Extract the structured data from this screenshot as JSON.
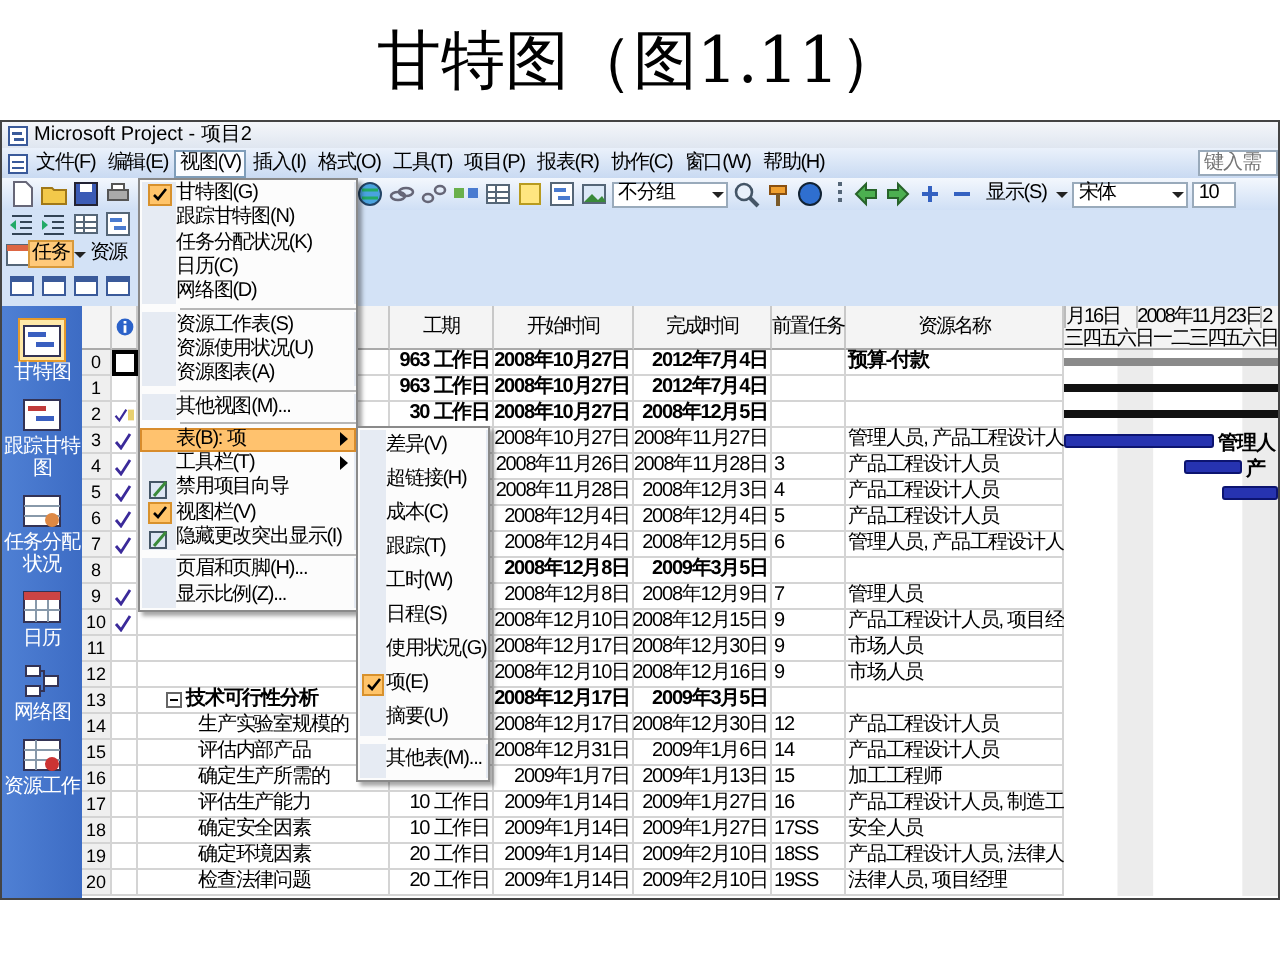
{
  "slide": {
    "title": "甘特图（图1.11）"
  },
  "window": {
    "title": "Microsoft Project - 项目2"
  },
  "menu_bar": [
    {
      "label": "文件(F)",
      "selected": false
    },
    {
      "label": "编辑(E)",
      "selected": false
    },
    {
      "label": "视图(V)",
      "selected": true
    },
    {
      "label": "插入(I)",
      "selected": false
    },
    {
      "label": "格式(O)",
      "selected": false
    },
    {
      "label": "工具(T)",
      "selected": false
    },
    {
      "label": "项目(P)",
      "selected": false
    },
    {
      "label": "报表(R)",
      "selected": false
    },
    {
      "label": "协作(C)",
      "selected": false
    },
    {
      "label": "窗口(W)",
      "selected": false
    },
    {
      "label": "帮助(H)",
      "selected": false
    }
  ],
  "help_box": {
    "placeholder": "键入需"
  },
  "toolbar": {
    "grouping": "不分组",
    "show_button": "显示(S)",
    "font": "宋体",
    "font_size": "10"
  },
  "view_tabs": [
    {
      "label": "任务",
      "selected": true
    },
    {
      "label": "资源",
      "selected": false
    }
  ],
  "view_bar": [
    {
      "label": "甘特图",
      "selected": true
    },
    {
      "label": "跟踪甘特图",
      "selected": false
    },
    {
      "label": "任务分配状况",
      "selected": false
    },
    {
      "label": "日历",
      "selected": false
    },
    {
      "label": "网络图",
      "selected": false
    },
    {
      "label": "资源工作",
      "selected": false
    }
  ],
  "view_menu": [
    {
      "kind": "item",
      "label": "甘特图(G)",
      "checked": true,
      "selected": false,
      "submenu": false
    },
    {
      "kind": "item",
      "label": "跟踪甘特图(N)",
      "checked": false,
      "selected": false,
      "submenu": false
    },
    {
      "kind": "item",
      "label": "任务分配状况(K)",
      "checked": false,
      "selected": false,
      "submenu": false
    },
    {
      "kind": "item",
      "label": "日历(C)",
      "checked": false,
      "selected": false,
      "submenu": false
    },
    {
      "kind": "item",
      "label": "网络图(D)",
      "checked": false,
      "selected": false,
      "submenu": false
    },
    {
      "kind": "separator"
    },
    {
      "kind": "item",
      "label": "资源工作表(S)",
      "checked": false,
      "selected": false,
      "submenu": false
    },
    {
      "kind": "item",
      "label": "资源使用状况(U)",
      "checked": false,
      "selected": false,
      "submenu": false
    },
    {
      "kind": "item",
      "label": "资源图表(A)",
      "checked": false,
      "selected": false,
      "submenu": false
    },
    {
      "kind": "separator"
    },
    {
      "kind": "item",
      "label": "其他视图(M)...",
      "checked": false,
      "selected": false,
      "submenu": false
    },
    {
      "kind": "separator"
    },
    {
      "kind": "item",
      "label": "表(B): 项",
      "checked": false,
      "selected": true,
      "submenu": true
    },
    {
      "kind": "item",
      "label": "工具栏(T)",
      "checked": false,
      "selected": false,
      "submenu": true
    },
    {
      "kind": "icon",
      "label": "禁用项目向导",
      "checked": false,
      "selected": false,
      "submenu": false
    },
    {
      "kind": "item",
      "label": "视图栏(V)",
      "checked": true,
      "selected": false,
      "submenu": false
    },
    {
      "kind": "icon",
      "label": "隐藏更改突出显示(I)",
      "checked": false,
      "selected": false,
      "submenu": false
    },
    {
      "kind": "separator"
    },
    {
      "kind": "item",
      "label": "页眉和页脚(H)...",
      "checked": false,
      "selected": false,
      "submenu": false
    },
    {
      "kind": "item",
      "label": "显示比例(Z)...",
      "checked": false,
      "selected": false,
      "submenu": false
    }
  ],
  "table_submenu": [
    {
      "kind": "item",
      "label": "差异(V)",
      "checked": false
    },
    {
      "kind": "item",
      "label": "超链接(H)",
      "checked": false
    },
    {
      "kind": "item",
      "label": "成本(C)",
      "checked": false
    },
    {
      "kind": "item",
      "label": "跟踪(T)",
      "checked": false
    },
    {
      "kind": "item",
      "label": "工时(W)",
      "checked": false
    },
    {
      "kind": "item",
      "label": "日程(S)",
      "checked": false
    },
    {
      "kind": "item",
      "label": "使用状况(G)",
      "checked": false
    },
    {
      "kind": "item",
      "label": "项(E)",
      "checked": true
    },
    {
      "kind": "item",
      "label": "摘要(U)",
      "checked": false
    },
    {
      "kind": "separator"
    },
    {
      "kind": "item",
      "label": "其他表(M)...",
      "checked": false
    }
  ],
  "table": {
    "columns": [
      "工期",
      "开始时间",
      "完成时间",
      "前置任务",
      "资源名称"
    ],
    "rows": [
      {
        "id": "0",
        "done": false,
        "note": false,
        "selected": true,
        "expanded": false,
        "summary": true,
        "duration": "963 工作日",
        "start": "2008年10月27日",
        "finish": "2012年7月4日",
        "resources": "预算-付款",
        "bar": {
          "kind": "project"
        }
      },
      {
        "id": "1",
        "done": false,
        "note": false,
        "selected": false,
        "expanded": false,
        "summary": true,
        "duration": "963 工作日",
        "start": "2008年10月27日",
        "finish": "2012年7月4日",
        "bar": {
          "kind": "summary"
        }
      },
      {
        "id": "2",
        "done": true,
        "note": true,
        "selected": false,
        "expanded": false,
        "summary": true,
        "duration": "30 工作日",
        "start": "2008年10月27日",
        "finish": "2008年12月5日",
        "bar": {
          "kind": "summary"
        }
      },
      {
        "id": "3",
        "done": true,
        "note": false,
        "selected": false,
        "expanded": false,
        "summary": false,
        "start": "2008年10月27日",
        "finish": "2008年11月27日",
        "resources": "管理人员, 产品工程设计人",
        "bar": {
          "kind": "task",
          "label": "管理人"
        }
      },
      {
        "id": "4",
        "done": true,
        "note": false,
        "selected": false,
        "expanded": false,
        "summary": false,
        "start": "2008年11月26日",
        "finish": "2008年11月28日",
        "predecessors": "3",
        "resources": "产品工程设计人员",
        "bar": {
          "kind": "task",
          "label": "产"
        }
      },
      {
        "id": "5",
        "done": true,
        "note": false,
        "selected": false,
        "expanded": false,
        "summary": false,
        "start": "2008年11月28日",
        "finish": "2008年12月3日",
        "predecessors": "4",
        "resources": "产品工程设计人员",
        "bar": {
          "kind": "task"
        }
      },
      {
        "id": "6",
        "done": true,
        "note": false,
        "selected": false,
        "expanded": false,
        "summary": false,
        "start": "2008年12月4日",
        "finish": "2008年12月4日",
        "predecessors": "5",
        "resources": "产品工程设计人员"
      },
      {
        "id": "7",
        "done": true,
        "note": false,
        "selected": false,
        "expanded": false,
        "summary": false,
        "start": "2008年12月4日",
        "finish": "2008年12月5日",
        "predecessors": "6",
        "resources": "管理人员, 产品工程设计人"
      },
      {
        "id": "8",
        "done": false,
        "note": false,
        "selected": false,
        "expanded": false,
        "summary": true,
        "start": "2008年12月8日",
        "finish": "2009年3月5日"
      },
      {
        "id": "9",
        "done": true,
        "note": false,
        "selected": false,
        "expanded": false,
        "summary": false,
        "start": "2008年12月8日",
        "finish": "2008年12月9日",
        "predecessors": "7",
        "resources": "管理人员"
      },
      {
        "id": "10",
        "done": true,
        "note": false,
        "selected": false,
        "expanded": false,
        "summary": false,
        "start": "2008年12月10日",
        "finish": "2008年12月15日",
        "predecessors": "9",
        "resources": "产品工程设计人员, 项目经"
      },
      {
        "id": "11",
        "done": false,
        "note": false,
        "selected": false,
        "expanded": false,
        "summary": false,
        "start": "2008年12月17日",
        "finish": "2008年12月30日",
        "predecessors": "9",
        "resources": "市场人员"
      },
      {
        "id": "12",
        "done": false,
        "note": false,
        "selected": false,
        "expanded": false,
        "summary": false,
        "start": "2008年12月10日",
        "finish": "2008年12月16日",
        "predecessors": "9",
        "resources": "市场人员"
      },
      {
        "id": "13",
        "done": false,
        "note": false,
        "selected": false,
        "expanded": true,
        "summary": true,
        "task": "技术可行性分析",
        "start": "2008年12月17日",
        "finish": "2009年3月5日",
        "children": [
          {
            "id": "14",
            "done": false,
            "note": false,
            "selected": false,
            "expanded": false,
            "summary": false,
            "task": "生产实验室规模的",
            "start": "2008年12月17日",
            "finish": "2008年12月30日",
            "predecessors": "12",
            "resources": "产品工程设计人员"
          },
          {
            "id": "15",
            "done": false,
            "note": false,
            "selected": false,
            "expanded": false,
            "summary": false,
            "task": "评估内部产品",
            "start": "2008年12月31日",
            "finish": "2009年1月6日",
            "predecessors": "14",
            "resources": "产品工程设计人员"
          },
          {
            "id": "16",
            "done": false,
            "note": false,
            "selected": false,
            "expanded": false,
            "summary": false,
            "task": "确定生产所需的",
            "start": "2009年1月7日",
            "finish": "2009年1月13日",
            "predecessors": "15",
            "resources": "加工工程师"
          },
          {
            "id": "17",
            "done": false,
            "note": false,
            "selected": false,
            "expanded": false,
            "summary": false,
            "task": "评估生产能力",
            "duration": "10 工作日",
            "start": "2009年1月14日",
            "finish": "2009年1月27日",
            "predecessors": "16",
            "resources": "产品工程设计人员, 制造工"
          },
          {
            "id": "18",
            "done": false,
            "note": false,
            "selected": false,
            "expanded": false,
            "summary": false,
            "task": "确定安全因素",
            "duration": "10 工作日",
            "start": "2009年1月14日",
            "finish": "2009年1月27日",
            "predecessors": "17SS",
            "resources": "安全人员"
          },
          {
            "id": "19",
            "done": false,
            "note": false,
            "selected": false,
            "expanded": false,
            "summary": false,
            "task": "确定环境因素",
            "duration": "20 工作日",
            "start": "2009年1月14日",
            "finish": "2009年2月10日",
            "predecessors": "18SS",
            "resources": "产品工程设计人员, 法律人"
          },
          {
            "id": "20",
            "done": false,
            "note": false,
            "selected": false,
            "expanded": false,
            "summary": false,
            "task": "检查法律问题",
            "duration": "20 工作日",
            "start": "2009年1月14日",
            "finish": "2009年2月10日",
            "predecessors": "19SS",
            "resources": "法律人员, 项目经理"
          }
        ]
      }
    ]
  },
  "gantt": {
    "dates": [
      "月16日",
      "2008年11月23日",
      "2"
    ],
    "days": [
      "三",
      "四",
      "五",
      "六",
      "日",
      "一",
      "二",
      "三",
      "四",
      "五",
      "六",
      "日"
    ]
  }
}
